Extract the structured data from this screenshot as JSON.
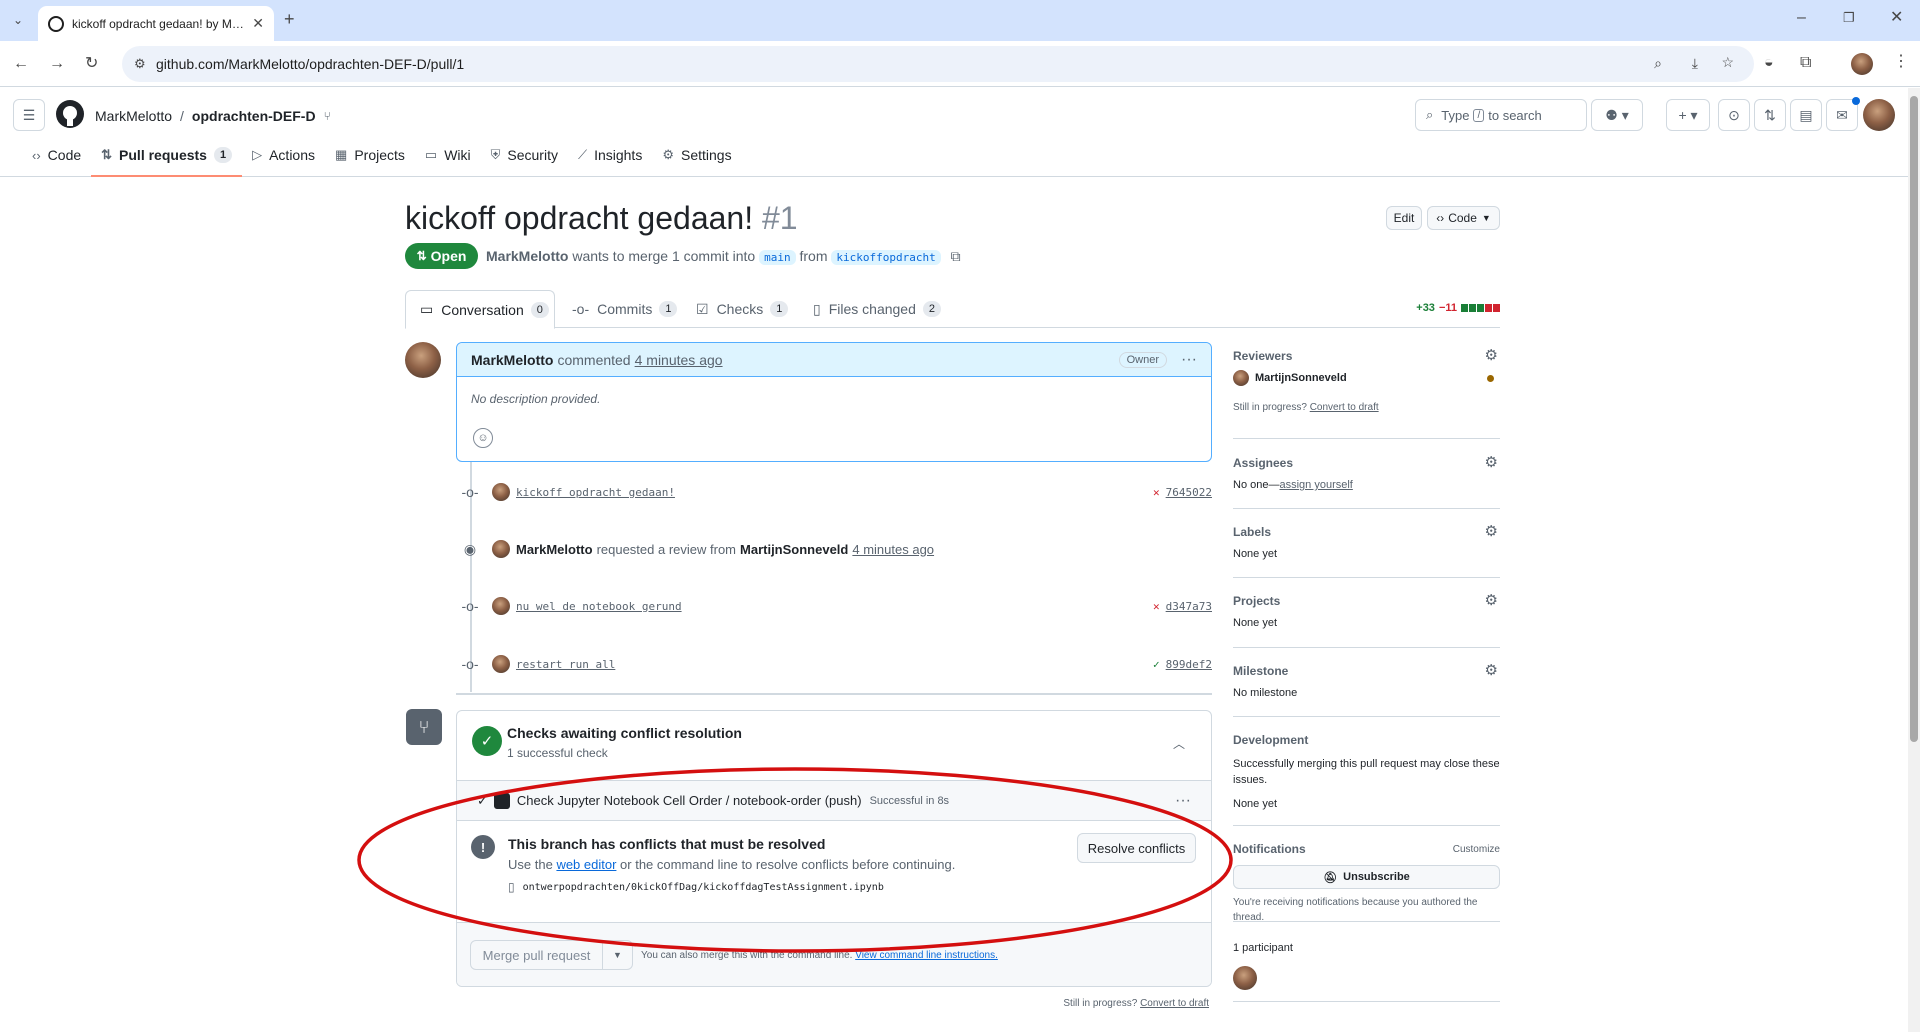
{
  "browser": {
    "tab_title": "kickoff opdracht gedaan! by M…",
    "url": "github.com/MarkMelotto/opdrachten-DEF-D/pull/1"
  },
  "header": {
    "owner": "MarkMelotto",
    "separator": "/",
    "repo": "opdrachten-DEF-D",
    "search_prefix": "Type",
    "search_key": "/",
    "search_suffix": "to search"
  },
  "repo_nav": [
    {
      "label": "Code",
      "icon": "code-icon"
    },
    {
      "label": "Pull requests",
      "icon": "pull-request-icon",
      "count": "1"
    },
    {
      "label": "Actions",
      "icon": "play-icon"
    },
    {
      "label": "Projects",
      "icon": "table-icon"
    },
    {
      "label": "Wiki",
      "icon": "book-icon"
    },
    {
      "label": "Security",
      "icon": "shield-icon"
    },
    {
      "label": "Insights",
      "icon": "graph-icon"
    },
    {
      "label": "Settings",
      "icon": "gear-icon"
    }
  ],
  "pr": {
    "title": "kickoff opdracht gedaan!",
    "number": "#1",
    "edit_label": "Edit",
    "code_label": "Code",
    "state": "Open",
    "author": "MarkMelotto",
    "merge_text": "wants to merge 1 commit into",
    "base": "main",
    "from_text": "from",
    "head": "kickoffopdracht"
  },
  "pr_tabs": [
    {
      "label": "Conversation",
      "count": "0"
    },
    {
      "label": "Commits",
      "count": "1"
    },
    {
      "label": "Checks",
      "count": "1"
    },
    {
      "label": "Files changed",
      "count": "2"
    }
  ],
  "diffstat": {
    "additions": "+33",
    "deletions": "−11"
  },
  "comment": {
    "author": "MarkMelotto",
    "verb": "commented",
    "time": "4 minutes ago",
    "badge": "Owner",
    "body": "No description provided."
  },
  "timeline": [
    {
      "type": "commit",
      "message": "kickoff opdracht gedaan!",
      "sha": "7645022",
      "status": "fail"
    },
    {
      "type": "review",
      "actor": "MarkMelotto",
      "text": "requested a review from",
      "reviewer": "MartijnSonneveld",
      "time": "4 minutes ago"
    },
    {
      "type": "commit",
      "message": "nu wel de notebook gerund",
      "sha": "d347a73",
      "status": "fail"
    },
    {
      "type": "commit",
      "message": "restart run all",
      "sha": "899def2",
      "status": "pass"
    }
  ],
  "merge": {
    "checks_title": "Checks awaiting conflict resolution",
    "checks_sub": "1 successful check",
    "check_name": "Check Jupyter Notebook Cell Order / notebook-order (push)",
    "check_status": "Successful in 8s",
    "conflict_title": "This branch has conflicts that must be resolved",
    "conflict_pre": "Use the",
    "conflict_link": "web editor",
    "conflict_post": "or the command line to resolve conflicts before continuing.",
    "conflict_file": "ontwerpopdrachten/0kickOffDag/kickoffdagTestAssignment.ipynb",
    "resolve_label": "Resolve conflicts",
    "merge_label": "Merge pull request",
    "also_text": "You can also merge this with the command line.",
    "cli_link": "View command line instructions.",
    "still_text": "Still in progress?",
    "draft_link": "Convert to draft"
  },
  "sidebar": {
    "reviewers_h": "Reviewers",
    "reviewer": "MartijnSonneveld",
    "still_text": "Still in progress?",
    "draft_link": "Convert to draft",
    "assignees_h": "Assignees",
    "assignees_pre": "No one—",
    "assign_link": "assign yourself",
    "labels_h": "Labels",
    "labels_v": "None yet",
    "projects_h": "Projects",
    "projects_v": "None yet",
    "milestone_h": "Milestone",
    "milestone_v": "No milestone",
    "development_h": "Development",
    "development_text": "Successfully merging this pull request may close these issues.",
    "development_v": "None yet",
    "notifications_h": "Notifications",
    "customize": "Customize",
    "unsubscribe": "Unsubscribe",
    "notif_text": "You're receiving notifications because you authored the thread.",
    "participants": "1 participant"
  },
  "colors": {
    "annotation": "#d40f0f",
    "open": "#1f883d",
    "accent": "#0969da"
  }
}
